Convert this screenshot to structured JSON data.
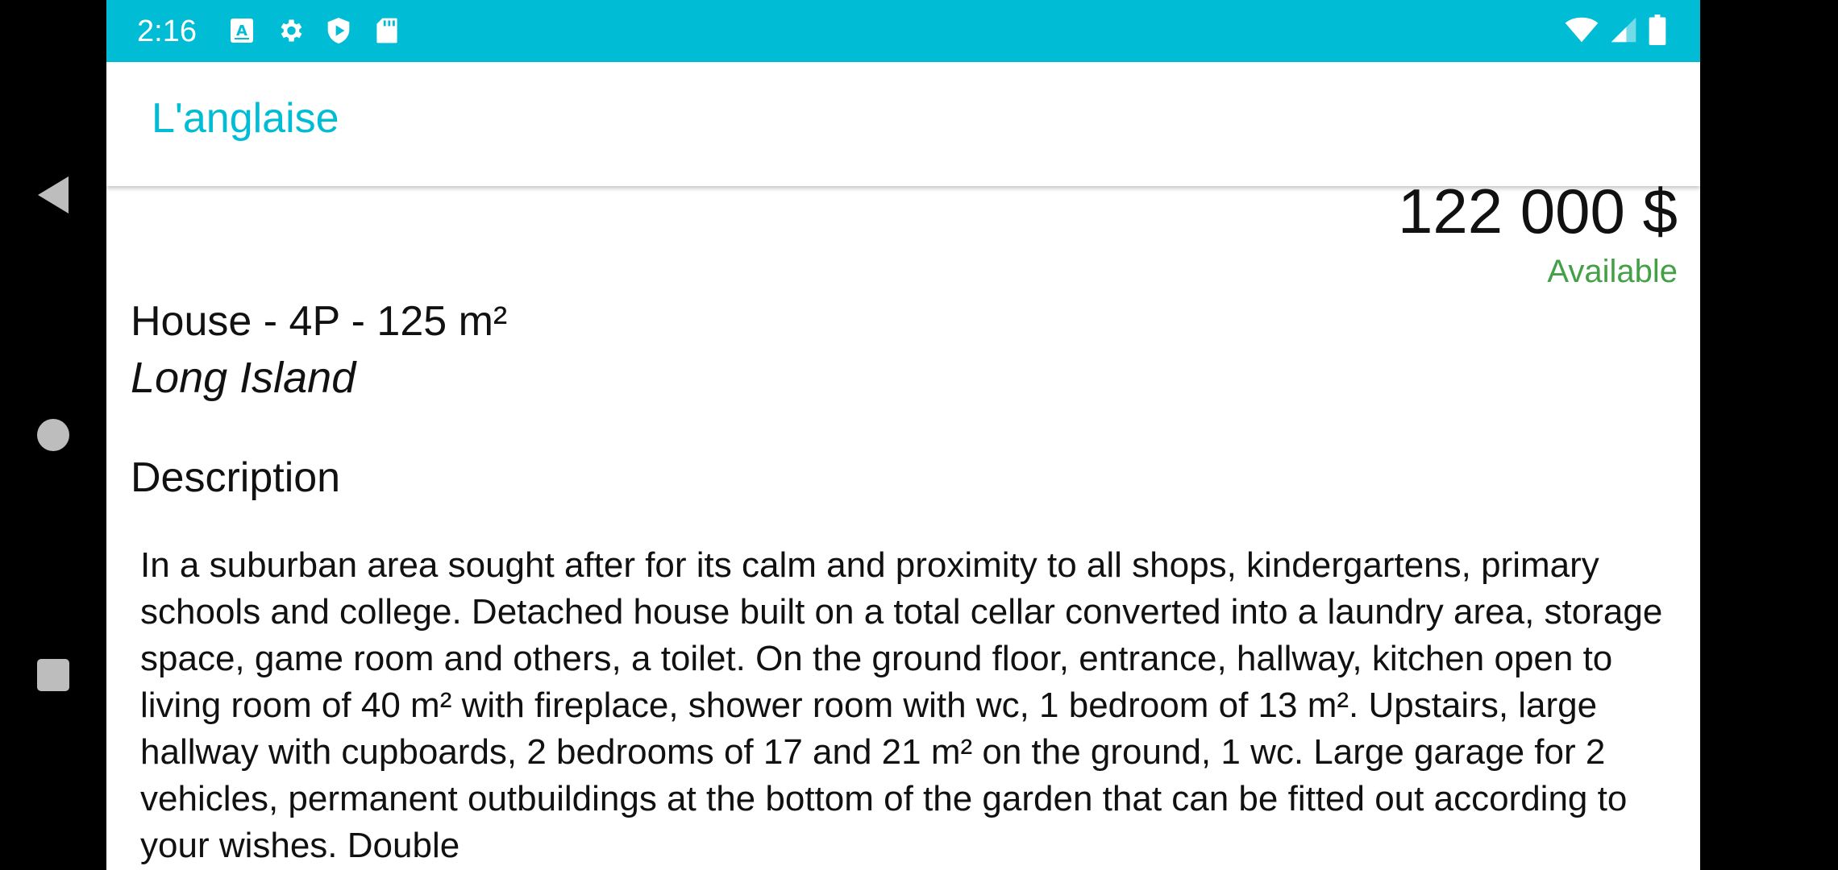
{
  "status_bar": {
    "time": "2:16",
    "left_icons": [
      "keyboard-a-icon",
      "gear-icon",
      "shield-play-icon",
      "sd-card-icon"
    ],
    "right_icons": [
      "wifi-icon",
      "cellular-signal-icon",
      "battery-icon"
    ],
    "color": "#00bcd4"
  },
  "app_bar": {
    "title": "L'anglaise"
  },
  "listing": {
    "price": "122 000 $",
    "status": "Available",
    "status_color": "#43a047",
    "title": "House - 4P - 125 m²",
    "location": "Long Island",
    "description_heading": "Description",
    "description": "In a suburban area sought after for its calm and proximity to all shops, kindergartens, primary schools and college. Detached house built on a total cellar converted into a laundry area, storage space, game room and others, a toilet. On the ground floor, entrance, hallway, kitchen open to living room of 40 m² with fireplace, shower room with wc, 1 bedroom of 13 m². Upstairs, large hallway with cupboards, 2 bedrooms of 17 and 21 m² on the ground, 1 wc. Large garage for 2 vehicles, permanent outbuildings at the bottom of the garden that can be fitted out according to your wishes. Double"
  },
  "nav_bar": {
    "buttons": [
      "back-icon",
      "home-icon",
      "recents-icon"
    ]
  }
}
